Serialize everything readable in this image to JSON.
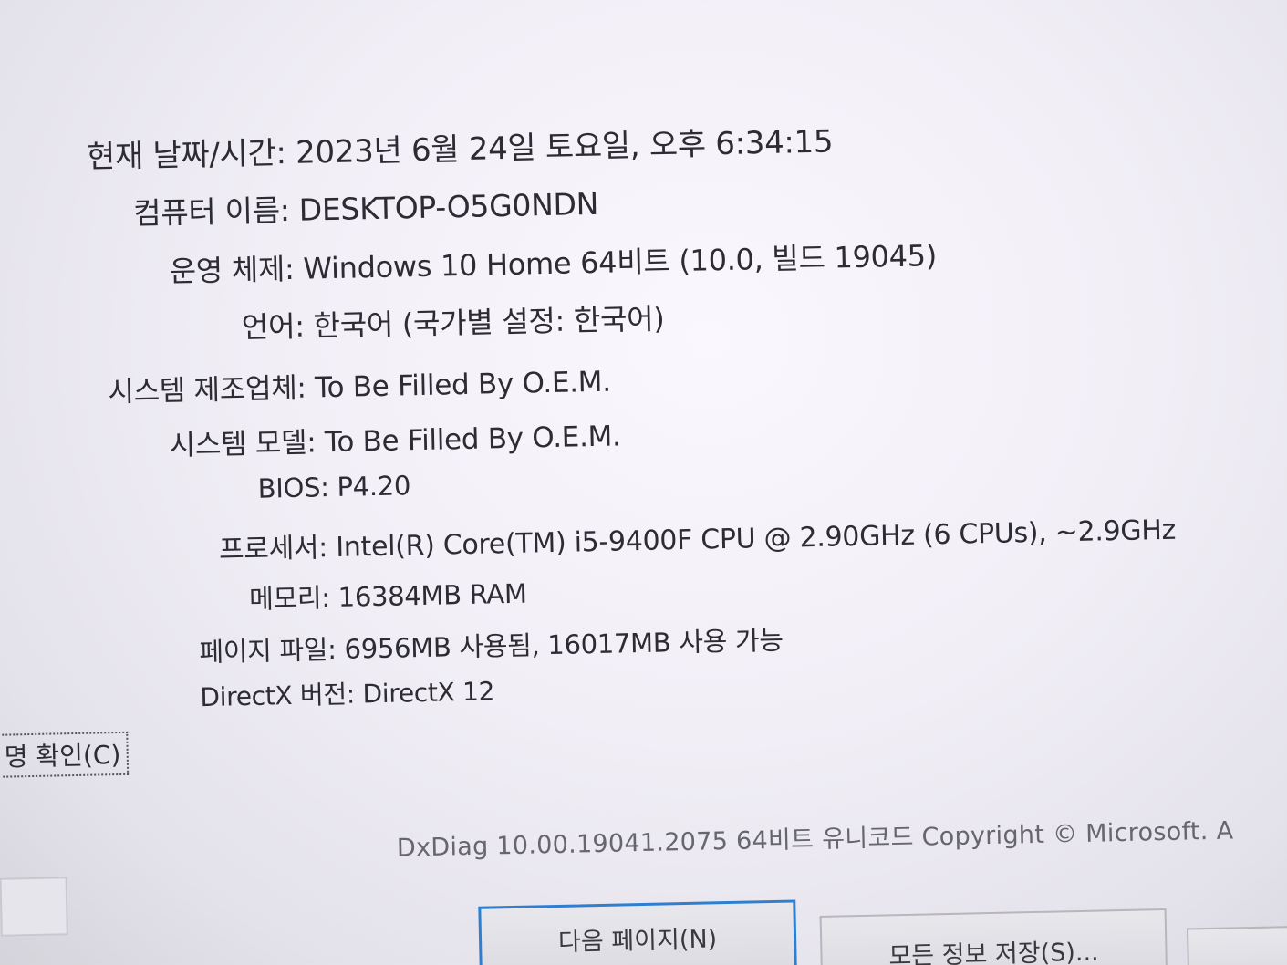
{
  "system_info": {
    "rows": [
      {
        "label": "현재 날짜/시간:",
        "value": "2023년 6월 24일 토요일, 오후 6:34:15"
      },
      {
        "label": "컴퓨터 이름:",
        "value": "DESKTOP-O5G0NDN"
      },
      {
        "label": "운영 체제:",
        "value": "Windows 10 Home 64비트 (10.0, 빌드 19045)"
      },
      {
        "label": "언어:",
        "value": "한국어 (국가별 설정: 한국어)"
      },
      {
        "label": "시스템 제조업체:",
        "value": "To Be Filled By O.E.M."
      },
      {
        "label": "시스템 모델:",
        "value": "To Be Filled By O.E.M."
      },
      {
        "label": "BIOS:",
        "value": "P4.20"
      },
      {
        "label": "프로세서:",
        "value": "Intel(R) Core(TM) i5-9400F CPU @ 2.90GHz (6 CPUs), ~2.9GHz"
      },
      {
        "label": "메모리:",
        "value": "16384MB RAM"
      },
      {
        "label": "페이지 파일:",
        "value": "6956MB 사용됨, 16017MB 사용 가능"
      },
      {
        "label": "DirectX 버전:",
        "value": "DirectX 12"
      }
    ]
  },
  "help_check_label": "명 확인(C)",
  "footer": {
    "version_text": "DxDiag 10.00.19041.2075 64비트 유니코드  Copyright © Microsoft. A"
  },
  "buttons": {
    "next_page": "다음 페이지(N)",
    "save_all": "모든 정보 저장(S)..."
  }
}
